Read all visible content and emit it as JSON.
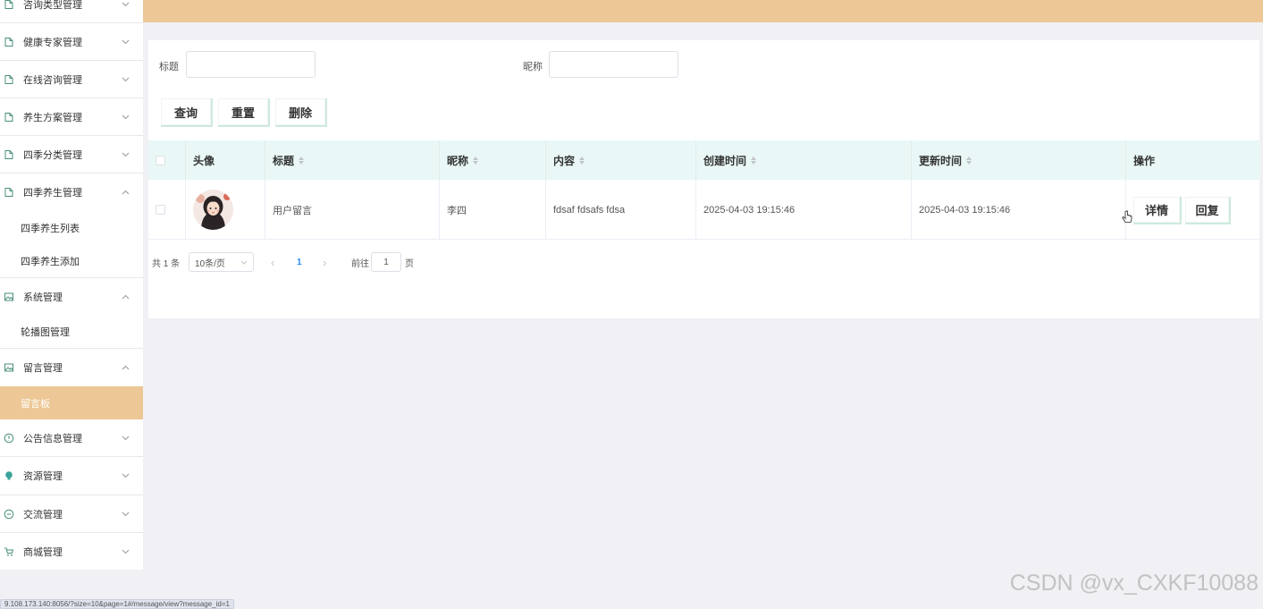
{
  "sidebar": {
    "menus": [
      {
        "label": "咨询类型管理",
        "icon": "document-icon",
        "arrow": "down"
      },
      {
        "label": "健康专家管理",
        "icon": "document-icon",
        "arrow": "down"
      },
      {
        "label": "在线咨询管理",
        "icon": "document-icon",
        "arrow": "down"
      },
      {
        "label": "养生方案管理",
        "icon": "document-icon",
        "arrow": "down"
      },
      {
        "label": "四季分类管理",
        "icon": "document-icon",
        "arrow": "down"
      },
      {
        "label": "四季养生管理",
        "icon": "document-icon",
        "arrow": "up"
      },
      {
        "label": "系统管理",
        "icon": "picture-icon",
        "arrow": "up"
      },
      {
        "label": "留言管理",
        "icon": "picture-icon",
        "arrow": "up"
      },
      {
        "label": "公告信息管理",
        "icon": "info-circle-icon",
        "arrow": "down"
      },
      {
        "label": "资源管理",
        "icon": "lightbulb-icon",
        "arrow": "down"
      },
      {
        "label": "交流管理",
        "icon": "chat-bubble-icon",
        "arrow": "down"
      },
      {
        "label": "商城管理",
        "icon": "cart-icon",
        "arrow": "down"
      }
    ],
    "subitems": [
      {
        "label": "四季养生列表"
      },
      {
        "label": "四季养生添加"
      },
      {
        "label": "轮播图管理"
      },
      {
        "label": "留言板"
      }
    ]
  },
  "search": {
    "title_label": "标题",
    "title_value": "",
    "nickname_label": "昵称",
    "nickname_value": ""
  },
  "toolbar": {
    "query": "查询",
    "reset": "重置",
    "delete": "删除"
  },
  "table": {
    "headers": {
      "avatar": "头像",
      "title": "标题",
      "nickname": "昵称",
      "content": "内容",
      "created": "创建时间",
      "updated": "更新时间",
      "actions": "操作"
    },
    "rows": [
      {
        "title": "用户留言",
        "nickname": "李四",
        "content": "fdsaf fdsafs fdsa",
        "created": "2025-04-03 19:15:46",
        "updated": "2025-04-03 19:15:46",
        "detail": "详情",
        "reply": "回复"
      }
    ]
  },
  "pager": {
    "total": "共 1 条",
    "page_size": "10条/页",
    "prev": "‹",
    "current": "1",
    "next": "›",
    "goto_prefix": "前往",
    "goto_value": "1",
    "goto_suffix": "页"
  },
  "status_url": "9.108.173.140:8056/?size=10&page=1#/message/view?message_id=1",
  "watermark": "CSDN @vx_CXKF10088",
  "colors": {
    "accent": "#edc896",
    "table_header_bg": "#e9f8f6",
    "button_border": "#cfe9dd"
  }
}
